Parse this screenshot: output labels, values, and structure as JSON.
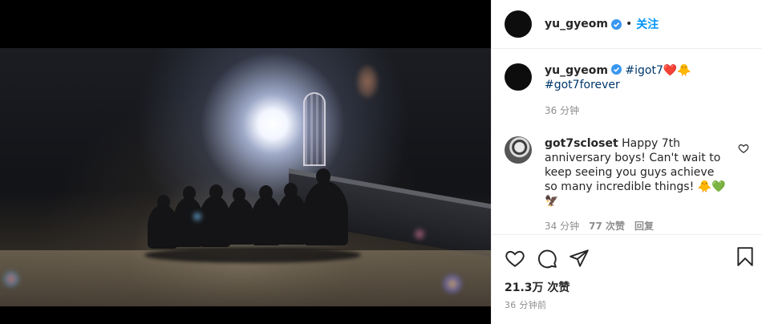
{
  "post": {
    "username": "yu_gyeom",
    "follow_separator": "•",
    "follow_label": "关注"
  },
  "caption": {
    "username": "yu_gyeom",
    "hashtag1": "#igot7",
    "hashtag2": "#got7forever",
    "emoji_heart": "❤️",
    "emoji_bird": "🐥",
    "time": "36 分钟"
  },
  "comment": {
    "username": "got7scloset",
    "text": "Happy 7th anniversary boys! Can't wait to keep seeing you guys achieve so many incredible things!",
    "emojis": "🐥💚🦅",
    "time": "34 分钟",
    "likes": "77 次赞",
    "reply": "回复"
  },
  "footer": {
    "likes": "21.3万 次赞",
    "time": "36 分钟前"
  },
  "icons": {
    "verified": "verified-badge-icon",
    "like": "heart-outline-icon",
    "comment": "comment-bubble-icon",
    "share": "paper-plane-icon",
    "save": "bookmark-icon"
  },
  "colors": {
    "accent": "#0095f6",
    "hashtag": "#00376b",
    "meta": "#8e8e8e"
  }
}
